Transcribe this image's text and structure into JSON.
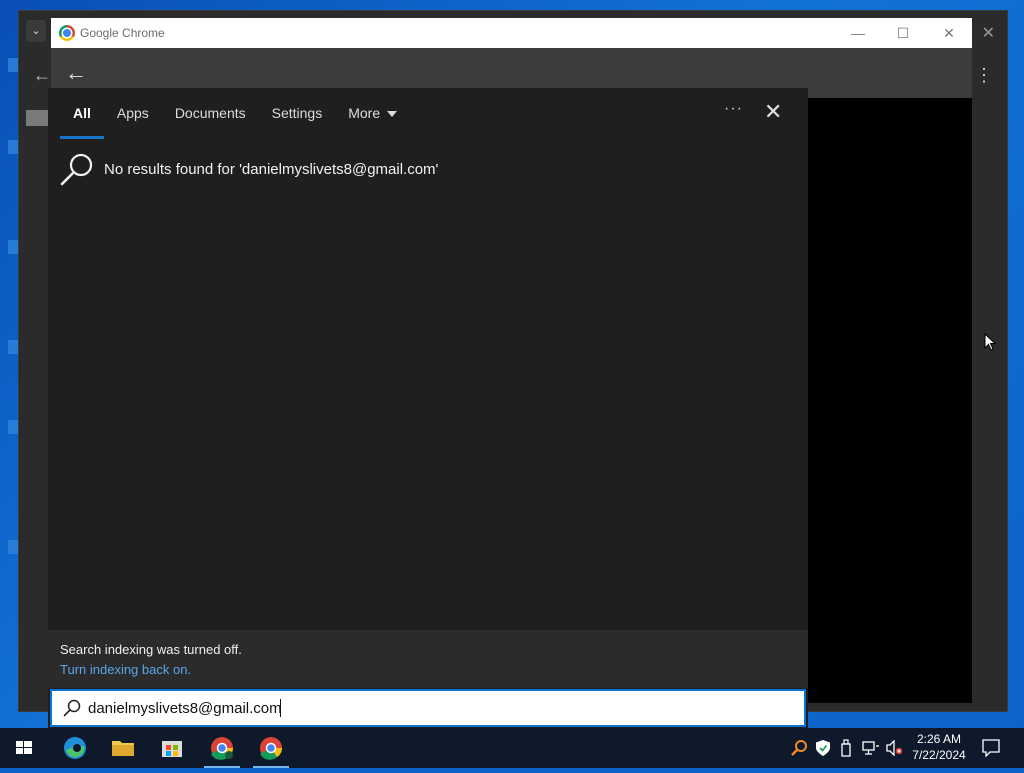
{
  "window": {
    "title": "Google Chrome"
  },
  "search_panel": {
    "tabs": [
      {
        "label": "All",
        "active": true
      },
      {
        "label": "Apps",
        "active": false
      },
      {
        "label": "Documents",
        "active": false
      },
      {
        "label": "Settings",
        "active": false
      },
      {
        "label": "More",
        "active": false
      }
    ],
    "ellipsis": "···",
    "close_glyph": "✕",
    "result_text": "No results found for 'danielmyslivets8@gmail.com'",
    "footer_message": "Search indexing was turned off.",
    "footer_link": "Turn indexing back on.",
    "query": "danielmyslivets8@gmail.com",
    "accent_color": "#1a73c9"
  },
  "taskbar": {
    "apps": [
      "windows-start",
      "microsoft-edge",
      "file-explorer",
      "microsoft-store",
      "google-chrome-profile",
      "google-chrome"
    ],
    "time": "2:26 AM",
    "date": "7/22/2024"
  }
}
